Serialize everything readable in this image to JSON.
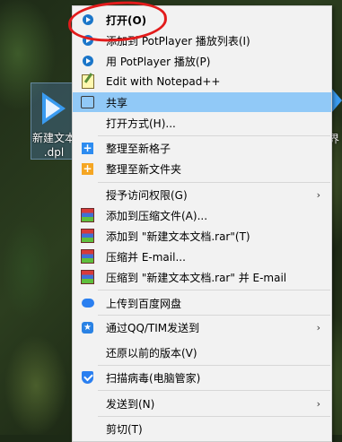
{
  "desktop": {
    "file_label_left": "新建文本\n.dpl",
    "file_label_right": "界\n"
  },
  "menu": {
    "items": [
      {
        "label": "打开(O)",
        "icon": "potplayer-icon",
        "bold": true
      },
      {
        "label": "添加到 PotPlayer 播放列表(I)",
        "icon": "potplayer-icon"
      },
      {
        "label": "用 PotPlayer 播放(P)",
        "icon": "potplayer-icon"
      },
      {
        "label": "Edit with Notepad++",
        "icon": "notepad-icon"
      },
      {
        "label": "共享",
        "icon": "share-icon",
        "highlighted": true
      },
      {
        "label": "打开方式(H)...",
        "icon": ""
      },
      {
        "label": "整理至新格子",
        "icon": "fences-blue-icon"
      },
      {
        "label": "整理至新文件夹",
        "icon": "fences-orange-icon"
      },
      {
        "label": "授予访问权限(G)",
        "icon": "",
        "submenu": true
      },
      {
        "label": "添加到压缩文件(A)...",
        "icon": "winrar-icon"
      },
      {
        "label": "添加到 \"新建文本文档.rar\"(T)",
        "icon": "winrar-icon"
      },
      {
        "label": "压缩并 E-mail...",
        "icon": "winrar-icon"
      },
      {
        "label": "压缩到 \"新建文本文档.rar\" 并 E-mail",
        "icon": "winrar-icon"
      },
      {
        "label": "上传到百度网盘",
        "icon": "baidu-icon"
      },
      {
        "label": "通过QQ/TIM发送到",
        "icon": "qq-icon",
        "submenu": true
      },
      {
        "label": "还原以前的版本(V)",
        "icon": ""
      },
      {
        "label": "扫描病毒(电脑管家)",
        "icon": "shield-icon"
      },
      {
        "label": "发送到(N)",
        "icon": "",
        "submenu": true
      },
      {
        "label": "剪切(T)",
        "icon": ""
      }
    ],
    "submenu_arrow": "›"
  },
  "colors": {
    "highlight": "#91c9f7",
    "menu_bg": "#f2f2f2",
    "annotation": "#e21b1b"
  }
}
